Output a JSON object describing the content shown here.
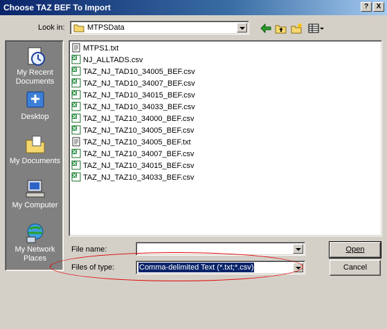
{
  "window": {
    "title": "Choose TAZ BEF To Import",
    "help_label": "?",
    "close_label": "X"
  },
  "lookin": {
    "label": "Look in:",
    "value": "MTPSData"
  },
  "toolbar": {
    "icons": [
      "back-arrow-icon",
      "up-folder-icon",
      "new-folder-icon",
      "view-menu-icon"
    ]
  },
  "places": [
    {
      "label": "My Recent Documents",
      "icon": "recent-documents-icon"
    },
    {
      "label": "Desktop",
      "icon": "desktop-icon"
    },
    {
      "label": "My Documents",
      "icon": "my-documents-icon"
    },
    {
      "label": "My Computer",
      "icon": "my-computer-icon"
    },
    {
      "label": "My Network Places",
      "icon": "network-places-icon"
    }
  ],
  "files": [
    {
      "name": "MTPS1.txt",
      "type": "txt"
    },
    {
      "name": "NJ_ALLTADS.csv",
      "type": "csv"
    },
    {
      "name": "TAZ_NJ_TAD10_34005_BEF.csv",
      "type": "csv"
    },
    {
      "name": "TAZ_NJ_TAD10_34007_BEF.csv",
      "type": "csv"
    },
    {
      "name": "TAZ_NJ_TAD10_34015_BEF.csv",
      "type": "csv"
    },
    {
      "name": "TAZ_NJ_TAD10_34033_BEF.csv",
      "type": "csv"
    },
    {
      "name": "TAZ_NJ_TAZ10_34000_BEF.csv",
      "type": "csv"
    },
    {
      "name": "TAZ_NJ_TAZ10_34005_BEF.csv",
      "type": "csv"
    },
    {
      "name": "TAZ_NJ_TAZ10_34005_BEF.txt",
      "type": "txt"
    },
    {
      "name": "TAZ_NJ_TAZ10_34007_BEF.csv",
      "type": "csv"
    },
    {
      "name": "TAZ_NJ_TAZ10_34015_BEF.csv",
      "type": "csv"
    },
    {
      "name": "TAZ_NJ_TAZ10_34033_BEF.csv",
      "type": "csv"
    }
  ],
  "filename": {
    "label": "File name:",
    "value": ""
  },
  "filetype": {
    "label": "Files of type:",
    "value": "Comma-delimited Text (*.txt;*.csv)"
  },
  "buttons": {
    "open": "Open",
    "cancel": "Cancel"
  },
  "colors": {
    "title_bar": "#0a246a",
    "selection": "#0a246a",
    "annotation": "#e00000",
    "places_bg": "#808080"
  }
}
